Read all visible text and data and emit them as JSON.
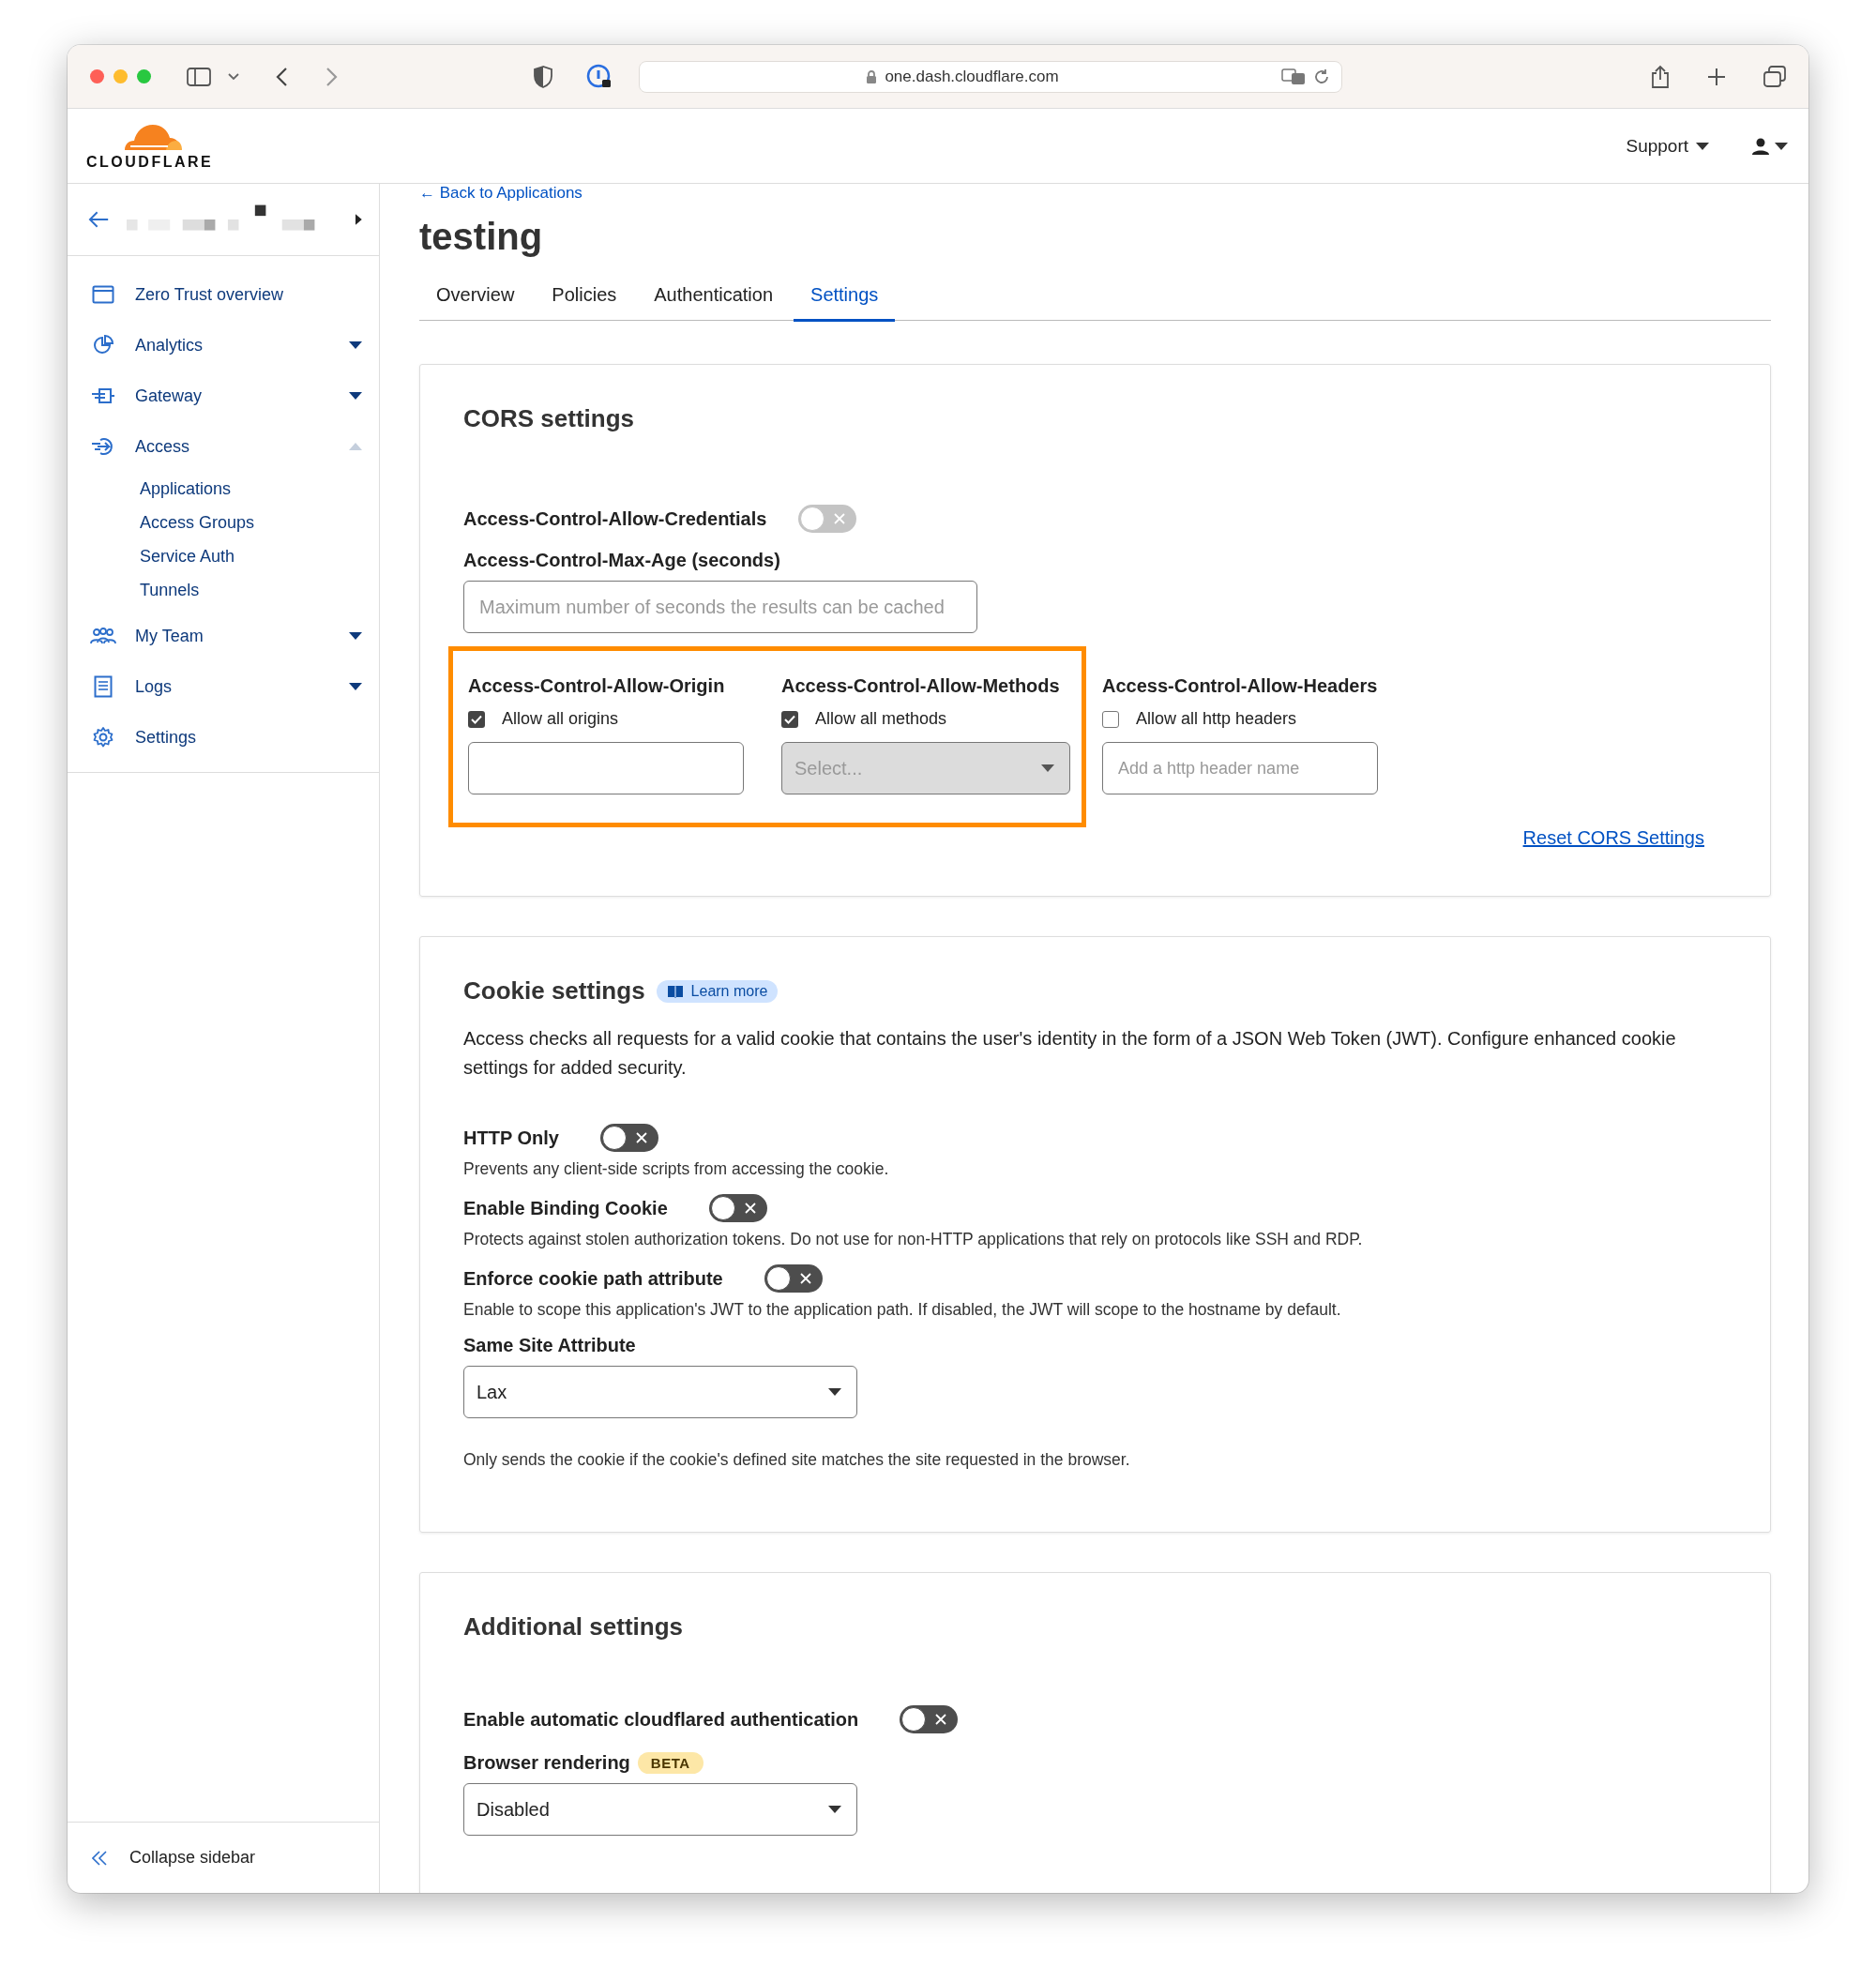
{
  "browser": {
    "url": "one.dash.cloudflare.com"
  },
  "header": {
    "logo_text": "CLOUDFLARE",
    "support": "Support"
  },
  "sidebar": {
    "items": [
      {
        "label": "Zero Trust overview"
      },
      {
        "label": "Analytics",
        "expanded": false
      },
      {
        "label": "Gateway",
        "expanded": false
      },
      {
        "label": "Access",
        "expanded": true,
        "children": [
          {
            "label": "Applications"
          },
          {
            "label": "Access Groups"
          },
          {
            "label": "Service Auth"
          },
          {
            "label": "Tunnels"
          }
        ]
      },
      {
        "label": "My Team",
        "expanded": false
      },
      {
        "label": "Logs",
        "expanded": false
      },
      {
        "label": "Settings"
      }
    ],
    "collapse": "Collapse sidebar"
  },
  "page": {
    "back_link": "← Back to Applications",
    "title": "testing",
    "tabs": [
      {
        "label": "Overview",
        "selected": false
      },
      {
        "label": "Policies",
        "selected": false
      },
      {
        "label": "Authentication",
        "selected": false
      },
      {
        "label": "Settings",
        "selected": true
      }
    ]
  },
  "cors": {
    "title": "CORS settings",
    "credentials": {
      "label": "Access-Control-Allow-Credentials",
      "on": false,
      "disabled": true
    },
    "max_age": {
      "label": "Access-Control-Max-Age (seconds)",
      "placeholder": "Maximum number of seconds the results can be cached"
    },
    "column_groups": [
      {
        "highlighted": true,
        "columns": [
          {
            "kind": "input",
            "label": "Access-Control-Allow-Origin",
            "checkbox": "Allow all origins",
            "checked": true
          },
          {
            "kind": "select",
            "label": "Access-Control-Allow-Methods",
            "checkbox": "Allow all methods",
            "checked": true,
            "disabled": true,
            "placeholder": "Select..."
          }
        ]
      },
      {
        "highlighted": false,
        "columns": [
          {
            "kind": "input",
            "label": "Access-Control-Allow-Headers",
            "checkbox": "Allow all http headers",
            "checked": false,
            "placeholder": "Add a http header name"
          }
        ]
      }
    ],
    "reset_link": "Reset CORS Settings"
  },
  "cookie": {
    "title": "Cookie settings",
    "learn_more": "Learn more",
    "description": "Access checks all requests for a valid cookie that contains the user's identity in the form of a JSON Web Token (JWT). Configure enhanced cookie settings for added security.",
    "toggles": [
      {
        "label": "HTTP Only",
        "on": false,
        "description": "Prevents any client-side scripts from accessing the cookie."
      },
      {
        "label": "Enable Binding Cookie",
        "on": false,
        "description": "Protects against stolen authorization tokens. Do not use for non-HTTP applications that rely on protocols like SSH and RDP."
      },
      {
        "label": "Enforce cookie path attribute",
        "on": false,
        "description": "Enable to scope this application's JWT to the application path. If disabled, the JWT will scope to the hostname by default."
      }
    ],
    "same_site": {
      "label": "Same Site Attribute",
      "value": "Lax",
      "note": "Only sends the cookie if the cookie's defined site matches the site requested in the browser."
    }
  },
  "additional": {
    "title": "Additional settings",
    "toggles": [
      {
        "label": "Enable automatic cloudflared authentication",
        "on": false
      }
    ],
    "browser_rendering": {
      "label": "Browser rendering",
      "badge": "BETA",
      "value": "Disabled"
    }
  }
}
